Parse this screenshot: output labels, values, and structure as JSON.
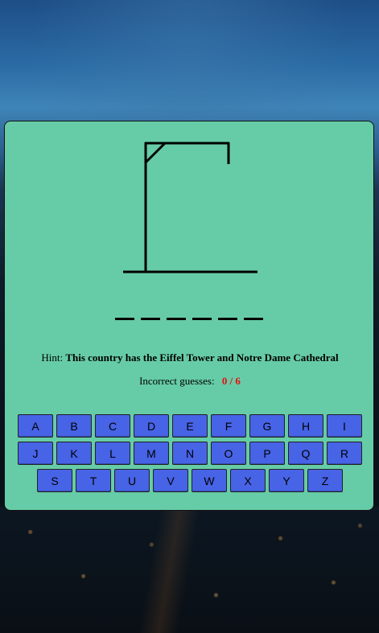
{
  "game": {
    "word_length": 6,
    "hint_label": "Hint:",
    "hint_text": "This country has the Eiffel Tower and Notre Dame Cathedral",
    "guesses_label": "Incorrect guesses:",
    "guesses_count": "0 / 6",
    "incorrect_guesses": 0,
    "max_guesses": 6
  },
  "keyboard": {
    "rows": [
      [
        "A",
        "B",
        "C",
        "D",
        "E",
        "F",
        "G",
        "H",
        "I"
      ],
      [
        "J",
        "K",
        "L",
        "M",
        "N",
        "O",
        "P",
        "Q",
        "R"
      ],
      [
        "S",
        "T",
        "U",
        "V",
        "W",
        "X",
        "Y",
        "Z"
      ]
    ]
  },
  "colors": {
    "card_background": "#66cca7",
    "key_background": "#4763e6",
    "guess_count": "#e21010"
  }
}
